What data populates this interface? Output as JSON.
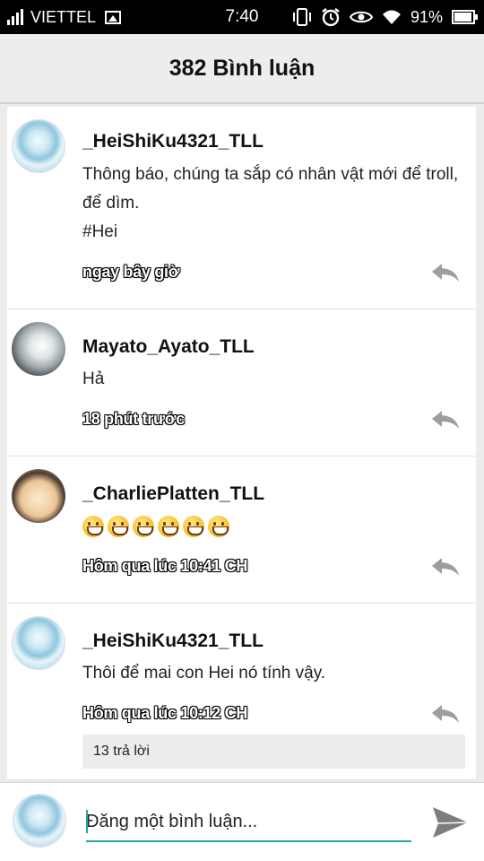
{
  "status_bar": {
    "carrier": "VIETTEL",
    "time": "7:40",
    "battery": "91%",
    "icons": [
      "signal-icon",
      "image-icon",
      "vibrate-icon",
      "alarm-icon",
      "eye-icon",
      "wifi-icon",
      "battery-icon"
    ]
  },
  "header": {
    "title": "382 Bình luận"
  },
  "comments": [
    {
      "author": "_HeiShiKu4321_TLL",
      "lines": [
        "Thông báo, chúng ta sắp có nhân vật mới để troll, để dìm.",
        "#Hei"
      ],
      "time": "ngay bây giờ"
    },
    {
      "author": "Mayato_Ayato_TLL",
      "lines": [
        "Hả"
      ],
      "time": "18 phút trước"
    },
    {
      "author": "_CharliePlatten_TLL",
      "emoji_count": 6,
      "time": "Hôm qua lúc 10:41 CH"
    },
    {
      "author": "_HeiShiKu4321_TLL",
      "lines": [
        "Thôi để mai con Hei nó tính vậy."
      ],
      "time": "Hôm qua lúc 10:12 CH",
      "replies": "13 trả lời"
    }
  ],
  "composer": {
    "placeholder": "Đăng một bình luận..."
  },
  "colors": {
    "accent": "#1fa6a6",
    "header_bg": "#ededed",
    "reply_icon": "#9e9e9e"
  }
}
